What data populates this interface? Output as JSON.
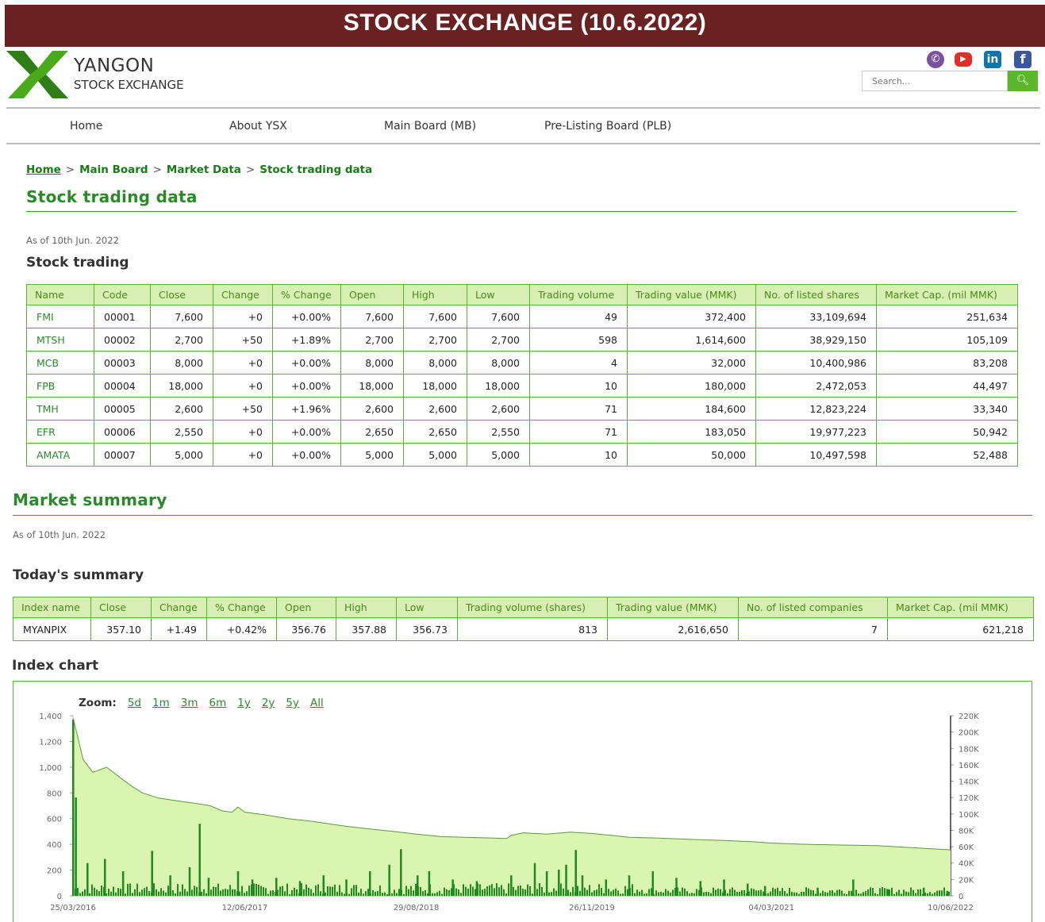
{
  "banner": "STOCK  EXCHANGE (10.6.2022)",
  "logo": {
    "line1": "YANGON",
    "line2": "STOCK EXCHANGE"
  },
  "search": {
    "placeholder": "Search..."
  },
  "social": [
    "viber-icon",
    "youtube-icon",
    "linkedin-icon",
    "facebook-icon"
  ],
  "nav": [
    "Home",
    "About YSX",
    "Main Board (MB)",
    "Pre-Listing Board (PLB)"
  ],
  "breadcrumb": [
    "Home",
    "Main Board",
    "Market Data",
    "Stock trading data"
  ],
  "page_title": "Stock trading data",
  "stock": {
    "as_of": "As of 10th Jun. 2022",
    "heading": "Stock trading",
    "headers": [
      "Name",
      "Code",
      "Close",
      "Change",
      "% Change",
      "Open",
      "High",
      "Low",
      "Trading volume",
      "Trading value (MMK)",
      "No. of listed shares",
      "Market Cap. (mil MMK)"
    ],
    "rows": [
      [
        "FMI",
        "00001",
        "7,600",
        "+0",
        "+0.00%",
        "7,600",
        "7,600",
        "7,600",
        "49",
        "372,400",
        "33,109,694",
        "251,634"
      ],
      [
        "MTSH",
        "00002",
        "2,700",
        "+50",
        "+1.89%",
        "2,700",
        "2,700",
        "2,700",
        "598",
        "1,614,600",
        "38,929,150",
        "105,109"
      ],
      [
        "MCB",
        "00003",
        "8,000",
        "+0",
        "+0.00%",
        "8,000",
        "8,000",
        "8,000",
        "4",
        "32,000",
        "10,400,986",
        "83,208"
      ],
      [
        "FPB",
        "00004",
        "18,000",
        "+0",
        "+0.00%",
        "18,000",
        "18,000",
        "18,000",
        "10",
        "180,000",
        "2,472,053",
        "44,497"
      ],
      [
        "TMH",
        "00005",
        "2,600",
        "+50",
        "+1.96%",
        "2,600",
        "2,600",
        "2,600",
        "71",
        "184,600",
        "12,823,224",
        "33,340"
      ],
      [
        "EFR",
        "00006",
        "2,550",
        "+0",
        "+0.00%",
        "2,650",
        "2,650",
        "2,550",
        "71",
        "183,050",
        "19,977,223",
        "50,942"
      ],
      [
        "AMATA",
        "00007",
        "5,000",
        "+0",
        "+0.00%",
        "5,000",
        "5,000",
        "5,000",
        "10",
        "50,000",
        "10,497,598",
        "52,488"
      ]
    ]
  },
  "market": {
    "title": "Market summary",
    "as_of": "As of 10th Jun. 2022",
    "heading": "Today's summary",
    "headers": [
      "Index name",
      "Close",
      "Change",
      "% Change",
      "Open",
      "High",
      "Low",
      "Trading volume (shares)",
      "Trading value (MMK)",
      "No. of listed companies",
      "Market Cap. (mil MMK)"
    ],
    "rows": [
      [
        "MYANPIX",
        "357.10",
        "+1.49",
        "+0.42%",
        "356.76",
        "357.88",
        "356.73",
        "813",
        "2,616,650",
        "7",
        "621,218"
      ]
    ]
  },
  "index_chart": {
    "heading": "Index chart",
    "zoom_label": "Zoom:",
    "zoom_options": [
      "5d",
      "1m",
      "3m",
      "6m",
      "1y",
      "2y",
      "5y",
      "All"
    ]
  },
  "colors": {
    "banner": "#692221",
    "green": "#2a8a2a",
    "header_bg": "#d8efb3",
    "area_fill": "#d9f5b0",
    "volume_bar": "#1f8a1f"
  },
  "chart_data": {
    "type": "area",
    "title": "",
    "left_axis": {
      "ticks": [
        "0",
        "200",
        "400",
        "600",
        "800",
        "1,000",
        "1,200",
        "1,400"
      ],
      "range": [
        0,
        1400
      ]
    },
    "right_axis": {
      "ticks": [
        "0",
        "20K",
        "40K",
        "60K",
        "80K",
        "100K",
        "120K",
        "140K",
        "160K",
        "180K",
        "200K",
        "220K"
      ],
      "range": [
        0,
        220000
      ]
    },
    "x_ticks": [
      "25/03/2016",
      "12/06/2017",
      "29/08/2018",
      "26/11/2019",
      "04/03/2021",
      "10/06/2022"
    ],
    "x_range": [
      "2016-03-25",
      "2022-06-10"
    ],
    "series": [
      {
        "type": "area",
        "points": [
          [
            "2016-03-25",
            1380
          ],
          [
            "2016-04-05",
            1250
          ],
          [
            "2016-04-20",
            1060
          ],
          [
            "2016-05-15",
            960
          ],
          [
            "2016-06-20",
            1000
          ],
          [
            "2016-07-20",
            930
          ],
          [
            "2016-08-20",
            860
          ],
          [
            "2016-09-20",
            800
          ],
          [
            "2016-11-01",
            760
          ],
          [
            "2016-12-15",
            740
          ],
          [
            "2017-02-01",
            720
          ],
          [
            "2017-03-15",
            700
          ],
          [
            "2017-04-15",
            660
          ],
          [
            "2017-05-10",
            650
          ],
          [
            "2017-05-25",
            690
          ],
          [
            "2017-06-12",
            650
          ],
          [
            "2017-08-01",
            630
          ],
          [
            "2017-10-01",
            600
          ],
          [
            "2017-12-01",
            580
          ],
          [
            "2018-01-15",
            560
          ],
          [
            "2018-03-01",
            540
          ],
          [
            "2018-05-01",
            520
          ],
          [
            "2018-07-01",
            500
          ],
          [
            "2018-08-29",
            480
          ],
          [
            "2018-11-01",
            460
          ],
          [
            "2019-01-01",
            455
          ],
          [
            "2019-03-01",
            450
          ],
          [
            "2019-04-20",
            445
          ],
          [
            "2019-05-01",
            470
          ],
          [
            "2019-06-01",
            490
          ],
          [
            "2019-08-01",
            480
          ],
          [
            "2019-10-01",
            495
          ],
          [
            "2019-11-26",
            485
          ],
          [
            "2020-01-15",
            470
          ],
          [
            "2020-03-01",
            455
          ],
          [
            "2020-05-01",
            450
          ],
          [
            "2020-08-01",
            440
          ],
          [
            "2020-11-01",
            430
          ],
          [
            "2021-01-15",
            420
          ],
          [
            "2021-03-04",
            410
          ],
          [
            "2021-06-01",
            400
          ],
          [
            "2021-09-01",
            395
          ],
          [
            "2021-12-01",
            390
          ],
          [
            "2022-03-01",
            375
          ],
          [
            "2022-06-10",
            357
          ]
        ]
      },
      {
        "type": "bar",
        "name": "volume",
        "axis": "right",
        "spikes": [
          [
            "2016-03-25",
            215000
          ],
          [
            "2016-04-01",
            120000
          ],
          [
            "2016-05-01",
            40000
          ],
          [
            "2016-06-15",
            45000
          ],
          [
            "2016-08-01",
            30000
          ],
          [
            "2016-10-15",
            55000
          ],
          [
            "2016-12-01",
            25000
          ],
          [
            "2017-01-20",
            35000
          ],
          [
            "2017-02-15",
            88000
          ],
          [
            "2017-03-10",
            22000
          ],
          [
            "2017-05-25",
            30000
          ],
          [
            "2017-07-01",
            20000
          ],
          [
            "2017-09-01",
            22000
          ],
          [
            "2017-11-01",
            18000
          ],
          [
            "2018-01-01",
            25000
          ],
          [
            "2018-03-01",
            20000
          ],
          [
            "2018-05-01",
            30000
          ],
          [
            "2018-06-20",
            38000
          ],
          [
            "2018-07-20",
            57000
          ],
          [
            "2018-09-01",
            25000
          ],
          [
            "2018-10-01",
            30000
          ],
          [
            "2018-12-01",
            20000
          ],
          [
            "2019-02-01",
            18000
          ],
          [
            "2019-05-01",
            25000
          ],
          [
            "2019-07-01",
            40000
          ],
          [
            "2019-08-01",
            30000
          ],
          [
            "2019-09-01",
            32000
          ],
          [
            "2019-09-20",
            38000
          ],
          [
            "2019-10-15",
            56000
          ],
          [
            "2019-11-01",
            25000
          ],
          [
            "2020-01-01",
            20000
          ],
          [
            "2020-03-01",
            25000
          ],
          [
            "2020-05-01",
            30000
          ],
          [
            "2020-07-01",
            22000
          ],
          [
            "2020-09-01",
            18000
          ],
          [
            "2020-11-01",
            20000
          ],
          [
            "2021-01-01",
            15000
          ],
          [
            "2021-02-15",
            12000
          ],
          [
            "2021-07-01",
            10000
          ],
          [
            "2021-10-01",
            20000
          ],
          [
            "2022-01-01",
            8000
          ],
          [
            "2022-04-01",
            10000
          ],
          [
            "2022-06-01",
            6000
          ]
        ]
      }
    ]
  }
}
